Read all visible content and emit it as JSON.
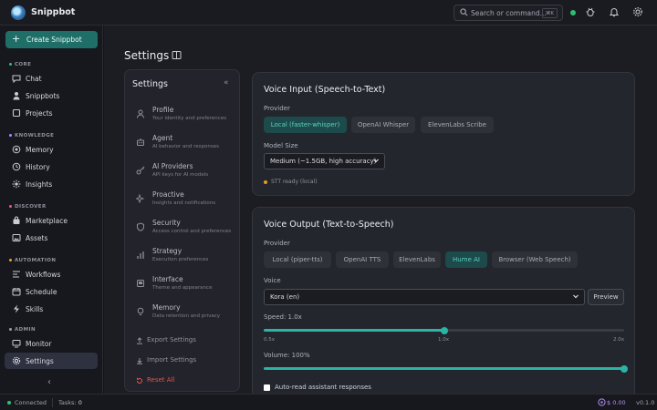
{
  "app": {
    "title": "Snippbot"
  },
  "topbar": {
    "search_placeholder": "Search or command...",
    "search_shortcut": "⌘K"
  },
  "sidebar": {
    "create_label": "Create Snippbot",
    "sections": [
      {
        "label": "CORE",
        "color": "#2fbf71"
      },
      {
        "label": "KNOWLEDGE",
        "color": "#a78bfa"
      },
      {
        "label": "DISCOVER",
        "color": "#ef5b7a"
      },
      {
        "label": "AUTOMATION",
        "color": "#f0a030"
      },
      {
        "label": "ADMIN",
        "color": "#9aa0aa"
      }
    ],
    "items": [
      {
        "label": "Chat",
        "icon": "chat-icon"
      },
      {
        "label": "Snippbots",
        "icon": "user-icon"
      },
      {
        "label": "Projects",
        "icon": "square-icon"
      },
      {
        "label": "Memory",
        "icon": "memory-icon"
      },
      {
        "label": "History",
        "icon": "clock-icon"
      },
      {
        "label": "Insights",
        "icon": "sparkle-icon"
      },
      {
        "label": "Marketplace",
        "icon": "bag-icon"
      },
      {
        "label": "Assets",
        "icon": "image-icon"
      },
      {
        "label": "Workflows",
        "icon": "workflow-icon"
      },
      {
        "label": "Schedule",
        "icon": "calendar-icon"
      },
      {
        "label": "Skills",
        "icon": "bolt-icon"
      },
      {
        "label": "Monitor",
        "icon": "monitor-icon"
      },
      {
        "label": "Settings",
        "icon": "gear-icon",
        "active": true
      }
    ]
  },
  "main": {
    "title": "Settings"
  },
  "settings_nav": {
    "title": "Settings",
    "items": [
      {
        "name": "Profile",
        "desc": "Your identity and preferences"
      },
      {
        "name": "Agent",
        "desc": "AI behavior and responses"
      },
      {
        "name": "AI Providers",
        "desc": "API keys for AI models"
      },
      {
        "name": "Proactive",
        "desc": "Insights and notifications"
      },
      {
        "name": "Security",
        "desc": "Access control and preferences"
      },
      {
        "name": "Strategy",
        "desc": "Execution preferences"
      },
      {
        "name": "Interface",
        "desc": "Theme and appearance"
      },
      {
        "name": "Memory",
        "desc": "Data retention and privacy"
      }
    ],
    "actions": {
      "export": "Export Settings",
      "import": "Import Settings",
      "reset": "Reset All"
    }
  },
  "voice_input": {
    "title": "Voice Input (Speech-to-Text)",
    "provider_label": "Provider",
    "providers": [
      "Local (faster-whisper)",
      "OpenAI Whisper",
      "ElevenLabs Scribe"
    ],
    "selected_provider": "Local (faster-whisper)",
    "model_label": "Model Size",
    "model_value": "Medium (~1.5GB, high accuracy)",
    "status": "STT ready (local)"
  },
  "voice_output": {
    "title": "Voice Output (Text-to-Speech)",
    "provider_label": "Provider",
    "providers": [
      "Local (piper-tts)",
      "OpenAI TTS",
      "ElevenLabs",
      "Hume AI",
      "Browser (Web Speech)"
    ],
    "selected_provider": "Hume AI",
    "voice_label": "Voice",
    "voice_value": "Kora (en)",
    "preview_label": "Preview",
    "speed_label": "Speed: 1.0x",
    "speed_value": 1.0,
    "speed_min": 0.5,
    "speed_max": 2.0,
    "speed_ticks": [
      "0.5x",
      "1.0x",
      "2.0x"
    ],
    "volume_label": "Volume: 100%",
    "volume_value": 1.0,
    "auto_read_label": "Auto-read assistant responses",
    "auto_read_checked": false
  },
  "footer": {
    "connection": "Connected",
    "tasks_label": "Tasks:",
    "tasks_count": "0",
    "cost": "$ 0.00",
    "version": "v0.1.0"
  },
  "colors": {
    "accent": "#2bb3a6",
    "brand_button": "#1f6e68",
    "danger": "#e0554e"
  }
}
